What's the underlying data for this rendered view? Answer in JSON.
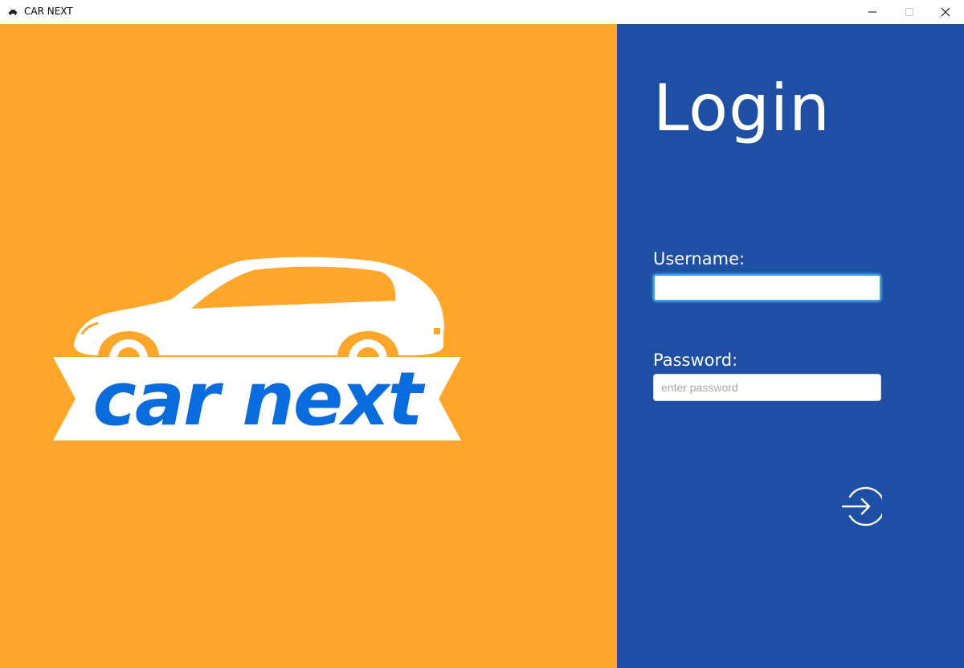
{
  "window": {
    "title": "CAR NEXT",
    "icon": "car-icon",
    "controls": [
      "minimize-icon",
      "maximize-icon",
      "close-icon"
    ]
  },
  "logo": {
    "text": "car next",
    "icon": "car-silhouette-icon"
  },
  "login": {
    "title": "Login",
    "username_label": "Username:",
    "username_value": "",
    "username_placeholder": "",
    "password_label": "Password:",
    "password_value": "",
    "password_placeholder": "enter password",
    "submit_icon": "sign-in-arrow-icon"
  },
  "colors": {
    "left_panel_bg": "#FFA62B",
    "right_panel_bg": "#1E4FA5",
    "logo_text": "#0A6BDD",
    "white": "#FFFFFF"
  }
}
